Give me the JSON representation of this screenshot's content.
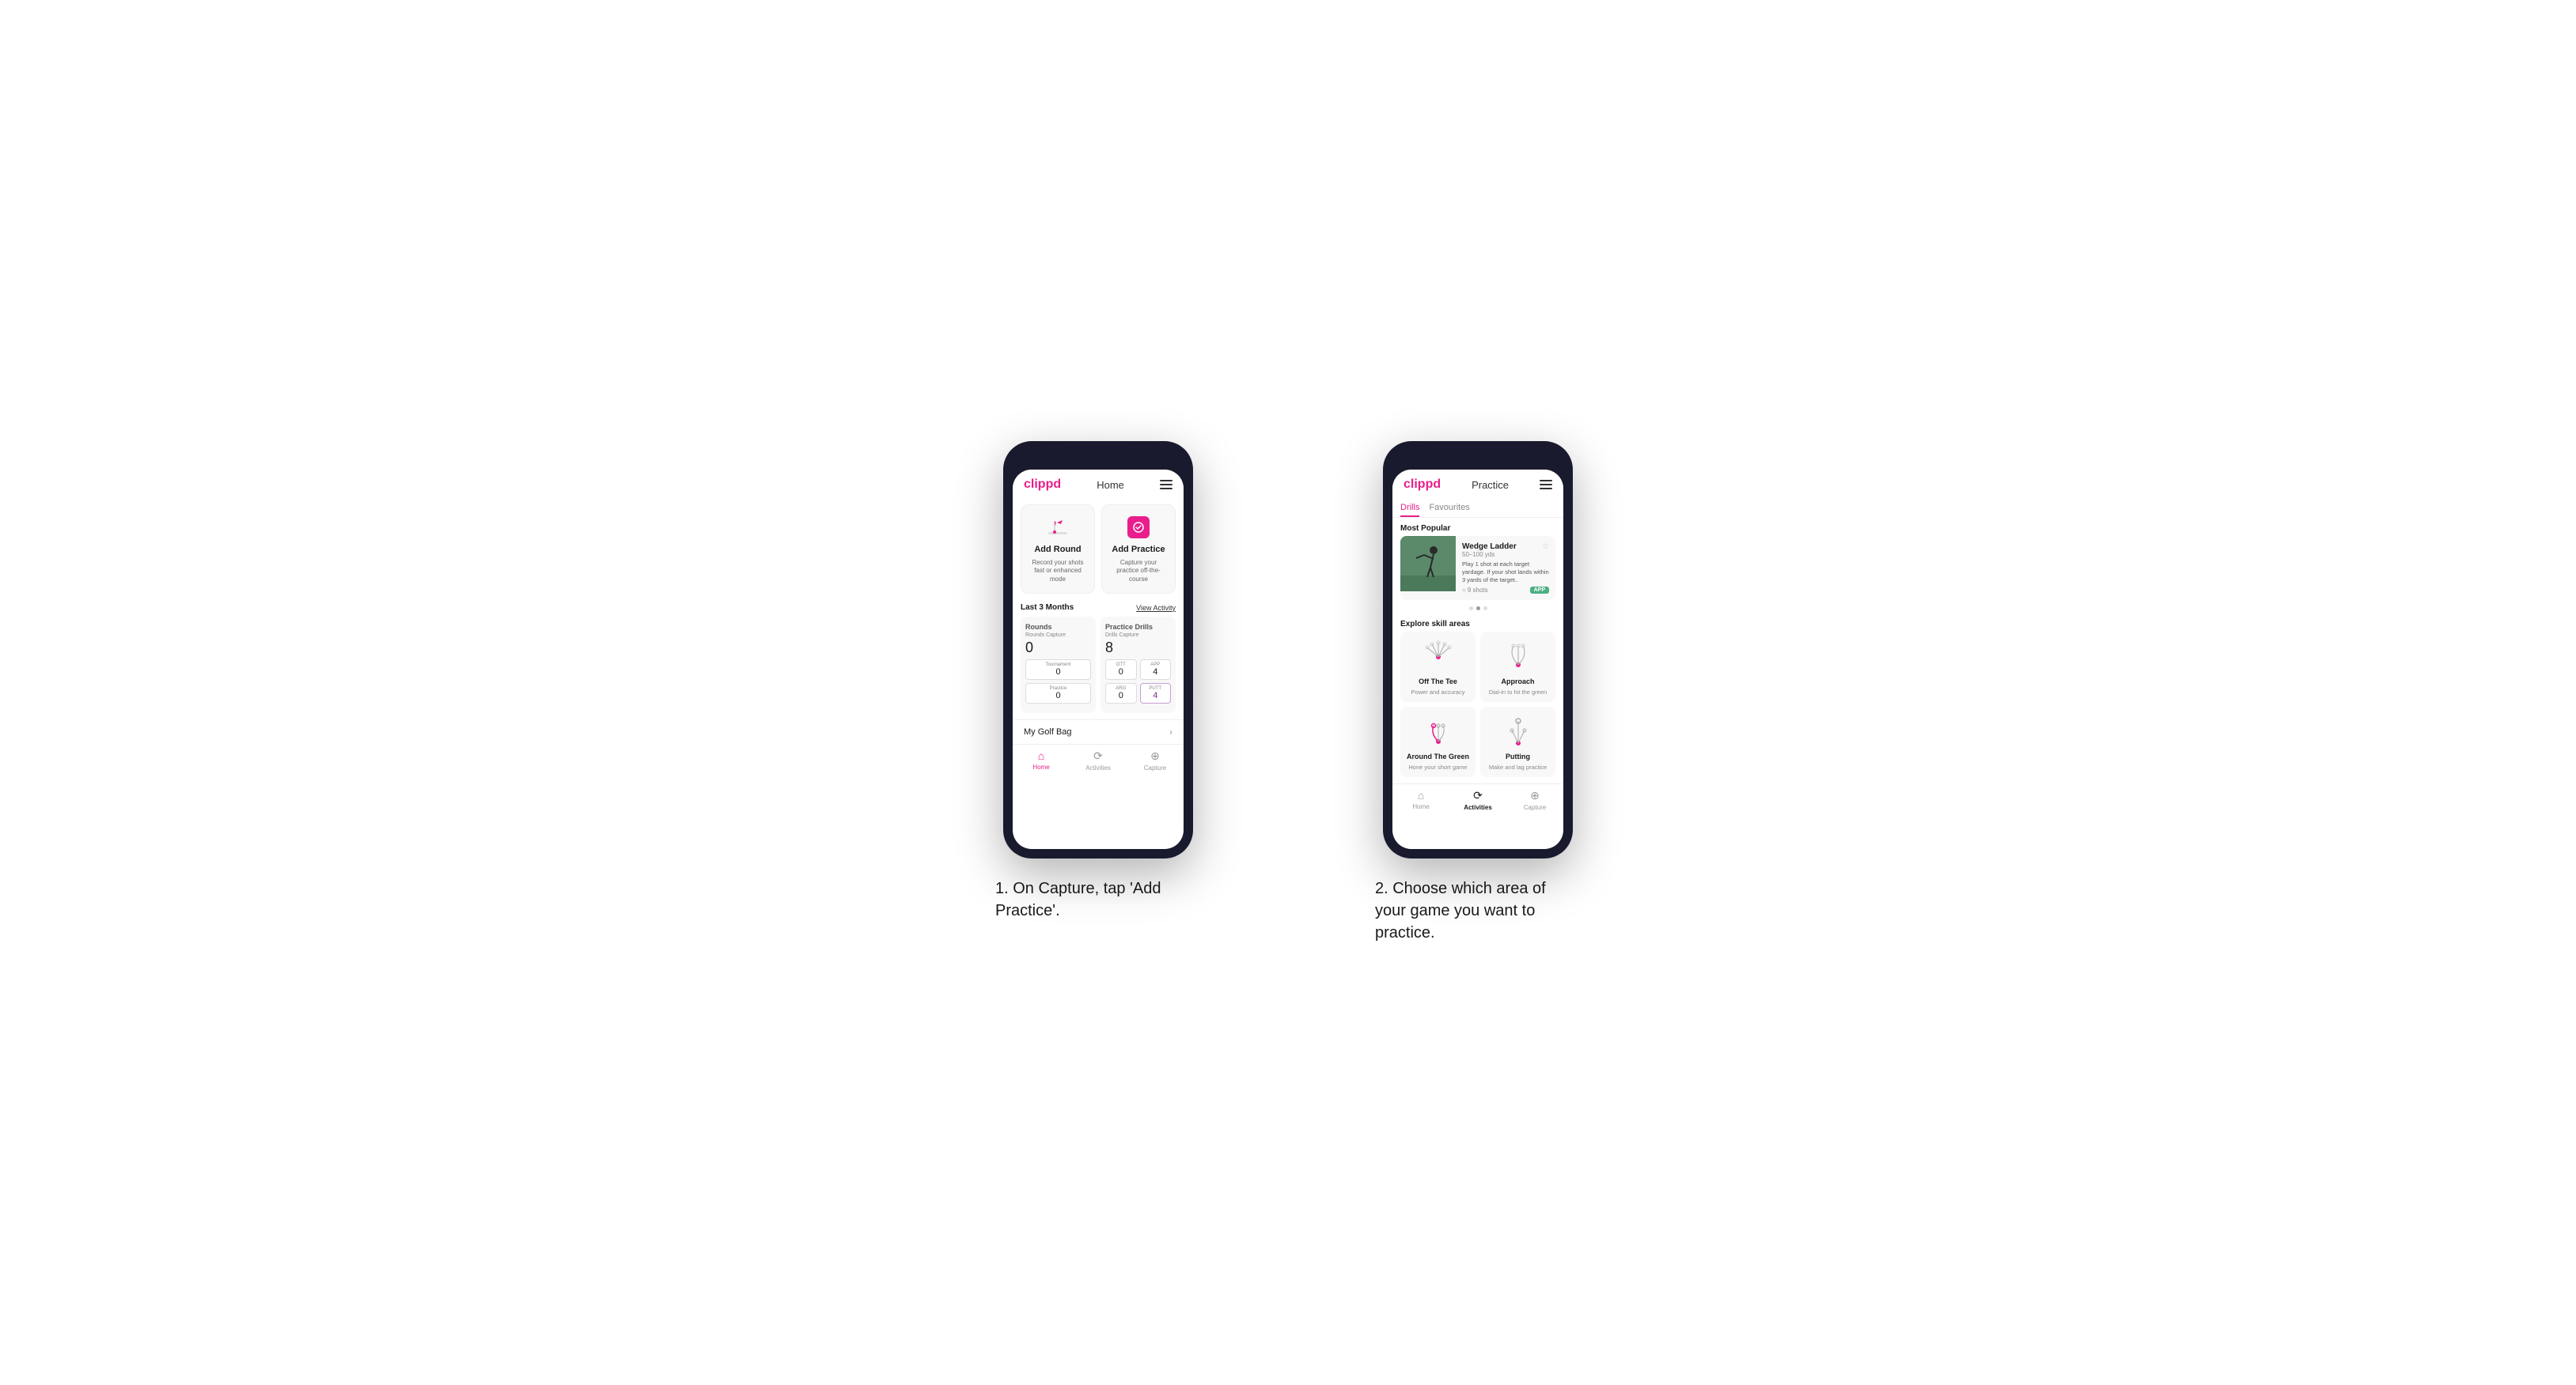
{
  "page": {
    "background": "#ffffff"
  },
  "phone1": {
    "logo": "clippd",
    "header_title": "Home",
    "add_round": {
      "title": "Add Round",
      "desc": "Record your shots fast or enhanced mode"
    },
    "add_practice": {
      "title": "Add Practice",
      "desc": "Capture your practice off-the-course"
    },
    "stats_period": "Last 3 Months",
    "view_activity": "View Activity",
    "rounds_label": "Rounds",
    "rounds_capture_label": "Rounds Capture",
    "rounds_value": "0",
    "tournament_label": "Tournament",
    "tournament_value": "0",
    "practice_label": "Practice",
    "practice_value": "0",
    "drills_label": "Practice Drills",
    "drills_capture_label": "Drills Capture",
    "drills_value": "8",
    "ott_label": "OTT",
    "ott_value": "0",
    "app_label": "APP",
    "app_value": "4",
    "arg_label": "ARG",
    "arg_value": "0",
    "putt_label": "PUTT",
    "putt_value": "4",
    "golf_bag_label": "My Golf Bag",
    "nav": {
      "home": "Home",
      "activities": "Activities",
      "capture": "Capture"
    }
  },
  "phone2": {
    "logo": "clippd",
    "header_title": "Practice",
    "tab_drills": "Drills",
    "tab_favourites": "Favourites",
    "most_popular_label": "Most Popular",
    "featured_card": {
      "title": "Wedge Ladder",
      "subtitle": "50–100 yds",
      "desc": "Play 1 shot at each target yardage. If your shot lands within 3 yards of the target..",
      "shots": "9 shots",
      "badge": "APP"
    },
    "explore_label": "Explore skill areas",
    "skill_areas": [
      {
        "title": "Off The Tee",
        "desc": "Power and accuracy"
      },
      {
        "title": "Approach",
        "desc": "Dial-in to hit the green"
      },
      {
        "title": "Around The Green",
        "desc": "Hone your short game"
      },
      {
        "title": "Putting",
        "desc": "Make and lag practice"
      }
    ],
    "nav": {
      "home": "Home",
      "activities": "Activities",
      "capture": "Capture"
    }
  },
  "caption1": "1. On Capture, tap 'Add Practice'.",
  "caption2": "2. Choose which area of your game you want to practice."
}
